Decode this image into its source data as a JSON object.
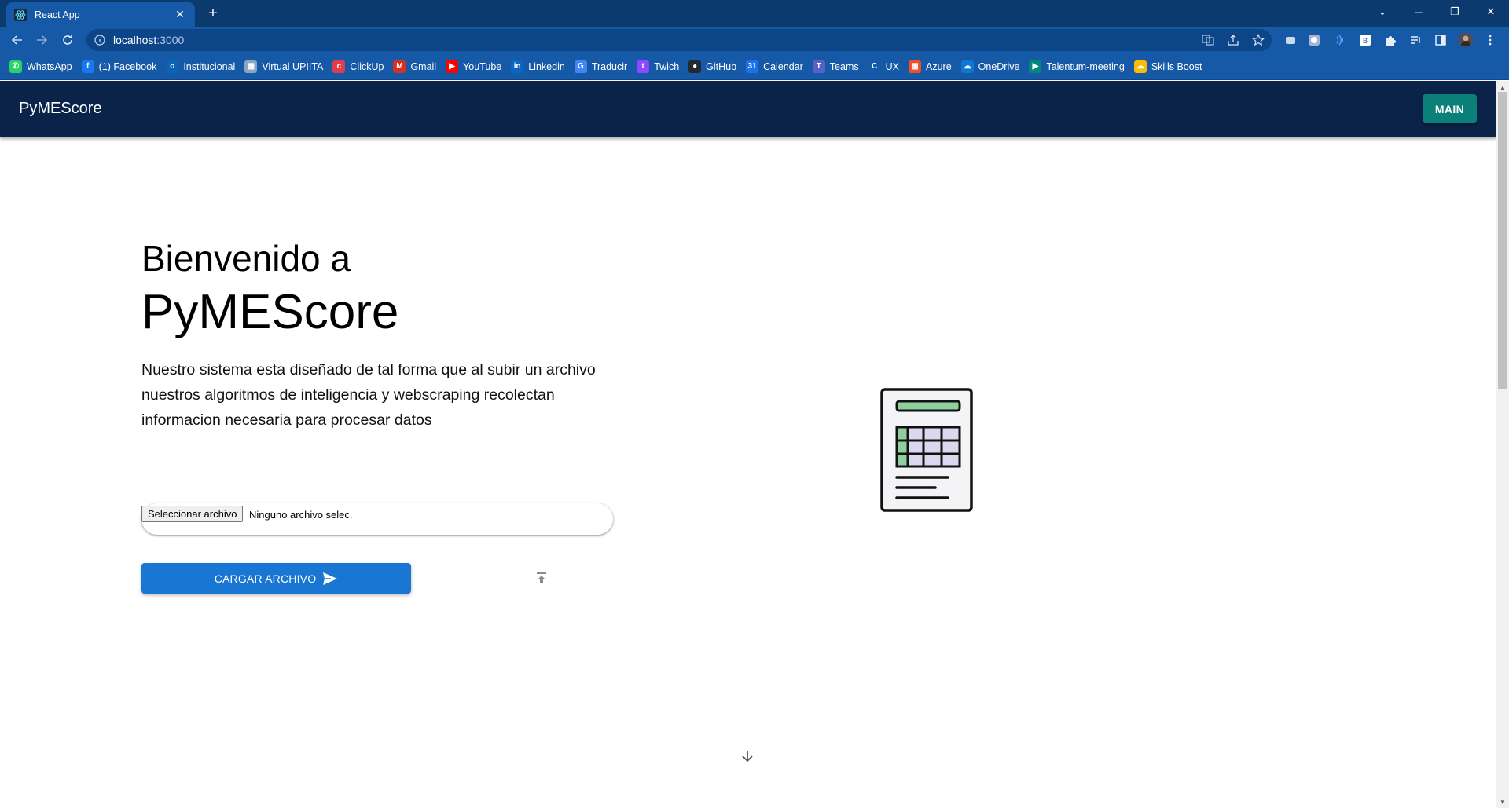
{
  "browser": {
    "tab_title": "React App",
    "new_tab": "+",
    "url_host": "localhost",
    "url_port": ":3000",
    "accent": "#1659a6"
  },
  "bookmarks": [
    {
      "label": "WhatsApp",
      "icon": "whatsapp-icon",
      "color": "#25d366",
      "glyph": "✆"
    },
    {
      "label": "(1) Facebook",
      "icon": "facebook-icon",
      "color": "#1877f2",
      "glyph": "f"
    },
    {
      "label": "Institucional",
      "icon": "outlook-icon",
      "color": "#0a64b4",
      "glyph": "o"
    },
    {
      "label": "Virtual UPIITA",
      "icon": "upiita-icon",
      "color": "#8aa6c4",
      "glyph": "▦"
    },
    {
      "label": "ClickUp",
      "icon": "clickup-icon",
      "color": "#e23b4d",
      "glyph": "c"
    },
    {
      "label": "Gmail",
      "icon": "gmail-icon",
      "color": "#d93025",
      "glyph": "M"
    },
    {
      "label": "YouTube",
      "icon": "youtube-icon",
      "color": "#ff0000",
      "glyph": "▶"
    },
    {
      "label": "Linkedin",
      "icon": "linkedin-icon",
      "color": "#0a66c2",
      "glyph": "in"
    },
    {
      "label": "Traducir",
      "icon": "translate-icon",
      "color": "#4285f4",
      "glyph": "G"
    },
    {
      "label": "Twich",
      "icon": "twitch-icon",
      "color": "#9146ff",
      "glyph": "t"
    },
    {
      "label": "GitHub",
      "icon": "github-icon",
      "color": "#24292f",
      "glyph": "●"
    },
    {
      "label": "Calendar",
      "icon": "calendar-icon",
      "color": "#1a73e8",
      "glyph": "31"
    },
    {
      "label": "Teams",
      "icon": "teams-icon",
      "color": "#5b5fc7",
      "glyph": "T"
    },
    {
      "label": "UX",
      "icon": "ux-icon",
      "color": "#1659a6",
      "glyph": "C"
    },
    {
      "label": "Azure",
      "icon": "microsoft-icon",
      "color": "#f25022",
      "glyph": "▦"
    },
    {
      "label": "OneDrive",
      "icon": "onedrive-icon",
      "color": "#0a78d4",
      "glyph": "☁"
    },
    {
      "label": "Talentum-meeting",
      "icon": "meet-icon",
      "color": "#00897b",
      "glyph": "▶"
    },
    {
      "label": "Skills Boost",
      "icon": "cloud-skills-icon",
      "color": "#fbbc04",
      "glyph": "☁"
    }
  ],
  "app": {
    "brand": "PyMEScore",
    "main_button": "MAIN",
    "colors": {
      "appbar": "#0b2349",
      "main_button": "#0b8078",
      "primary": "#1976d2"
    }
  },
  "hero": {
    "title_small": "Bienvenido a",
    "title_big": "PyMEScore",
    "description": "Nuestro sistema esta diseñado de tal forma que al subir un archivo nuestros algoritmos de inteligencia y webscraping recolectan informacion necesaria para procesar datos"
  },
  "upload": {
    "file_button": "Seleccionar archivo",
    "file_status": "Ninguno archivo selec.",
    "submit_label": "CARGAR ARCHIVO"
  }
}
